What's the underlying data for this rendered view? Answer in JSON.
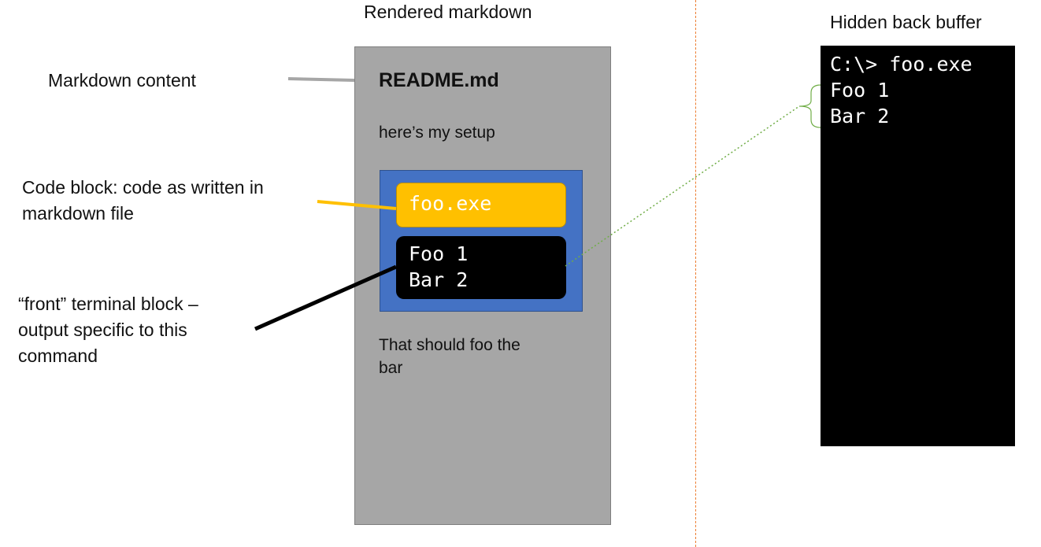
{
  "headings": {
    "rendered": "Rendered markdown",
    "hidden": "Hidden back buffer"
  },
  "annotations": {
    "markdown_content": "Markdown content",
    "code_block_line1": "Code block: code as written in",
    "code_block_line2": "markdown file",
    "front_terminal_line1": "“front” terminal block –",
    "front_terminal_line2": "output specific to this",
    "front_terminal_line3": "command"
  },
  "markdown": {
    "title": "README.md",
    "intro": "here’s my setup",
    "code": "foo.exe",
    "output_lines": [
      "Foo 1",
      "Bar 2"
    ],
    "after_line1": "That should foo the",
    "after_line2": "bar"
  },
  "back_buffer": {
    "lines": [
      "C:\\> foo.exe",
      "Foo 1",
      "Bar 2"
    ]
  },
  "colors": {
    "panel_gray": "#a6a6a6",
    "code_container_blue": "#4472c4",
    "code_block_yellow": "#ffc000",
    "terminal_black": "#000000",
    "divider_orange": "#ed7d31",
    "connector_green": "#70ad47"
  }
}
